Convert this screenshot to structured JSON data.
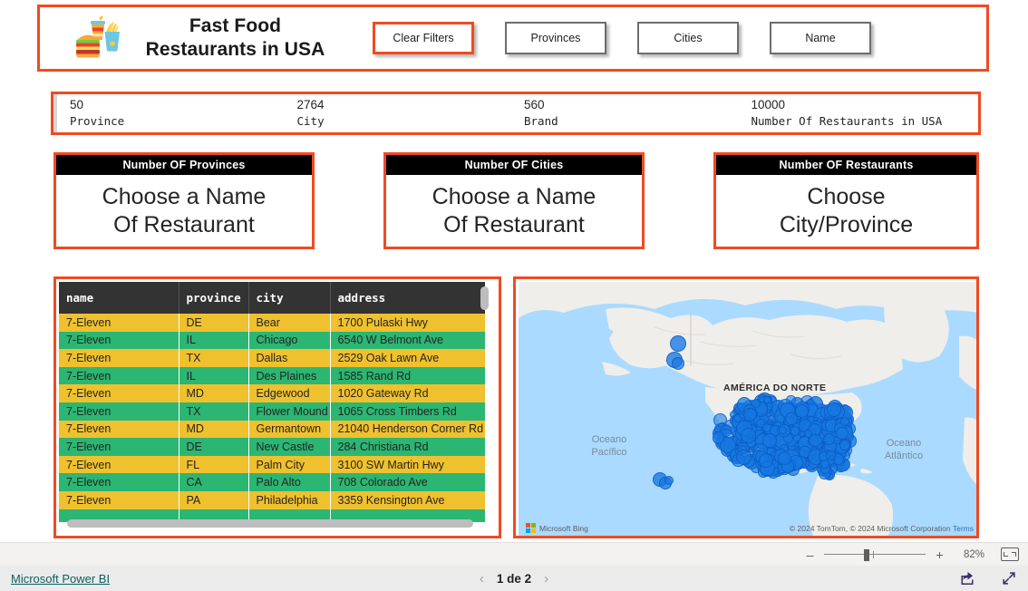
{
  "header": {
    "logo_icon": "fast-food-icon",
    "title_line1": "Fast Food",
    "title_line2": "Restaurants in USA",
    "buttons": [
      {
        "label": "Clear Filters",
        "accent": true
      },
      {
        "label": "Provinces",
        "accent": false
      },
      {
        "label": "Cities",
        "accent": false
      },
      {
        "label": "Name",
        "accent": false
      }
    ]
  },
  "kpis": [
    {
      "value": "50",
      "label": "Province"
    },
    {
      "value": "2764",
      "label": "City"
    },
    {
      "value": "560",
      "label": "Brand"
    },
    {
      "value": "10000",
      "label": "Number Of Restaurants in USA"
    }
  ],
  "cards": [
    {
      "title": "Number OF Provinces",
      "body_line1": "Choose a Name",
      "body_line2": "Of Restaurant"
    },
    {
      "title": "Number OF Cities",
      "body_line1": "Choose a Name",
      "body_line2": "Of Restaurant"
    },
    {
      "title": "Number OF Restaurants",
      "body_line1": "Choose",
      "body_line2": "City/Province"
    }
  ],
  "table": {
    "columns": [
      "name",
      "province",
      "city",
      "address"
    ],
    "rows": [
      [
        "7-Eleven",
        "DE",
        "Bear",
        "1700 Pulaski Hwy"
      ],
      [
        "7-Eleven",
        "IL",
        "Chicago",
        "6540 W Belmont Ave"
      ],
      [
        "7-Eleven",
        "TX",
        "Dallas",
        "2529 Oak Lawn Ave"
      ],
      [
        "7-Eleven",
        "IL",
        "Des Plaines",
        "1585 Rand Rd"
      ],
      [
        "7-Eleven",
        "MD",
        "Edgewood",
        "1020 Gateway Rd"
      ],
      [
        "7-Eleven",
        "TX",
        "Flower Mound",
        "1065 Cross Timbers Rd"
      ],
      [
        "7-Eleven",
        "MD",
        "Germantown",
        "21040 Henderson Corner Rd"
      ],
      [
        "7-Eleven",
        "DE",
        "New Castle",
        "284 Christiana Rd"
      ],
      [
        "7-Eleven",
        "FL",
        "Palm City",
        "3100 SW Martin Hwy"
      ],
      [
        "7-Eleven",
        "CA",
        "Palo Alto",
        "708 Colorado Ave"
      ],
      [
        "7-Eleven",
        "PA",
        "Philadelphia",
        "3359 Kensington Ave"
      ],
      [
        "",
        "",
        "",
        ""
      ]
    ]
  },
  "map": {
    "continent_label": "AMÉRICA DO NORTE",
    "ocean_left_line1": "Oceano",
    "ocean_left_line2": "Pacífico",
    "ocean_right_line1": "Oceano",
    "ocean_right_line2": "Atlântico",
    "bing_label": "Microsoft Bing",
    "attribution": "© 2024 TomTom, © 2024 Microsoft Corporation",
    "terms_label": "Terms"
  },
  "zoombar": {
    "minus_label": "–",
    "plus_label": "+",
    "percent": "82%",
    "fit_icon": "fit-to-page-icon"
  },
  "footer": {
    "brand_link": "Microsoft Power BI",
    "prev_icon": "chevron-left-icon",
    "page_label": "1 de 2",
    "next_icon": "chevron-right-icon",
    "share_icon": "share-icon",
    "fullscreen_icon": "fullscreen-icon"
  },
  "colors": {
    "accent_outline": "#f04a23",
    "row_yellow": "#efc12e",
    "row_green": "#2bb673",
    "header_dark": "#333333",
    "map_water": "#aadaff",
    "map_land": "#efeeea",
    "bubble_blue": "#1778e2"
  }
}
